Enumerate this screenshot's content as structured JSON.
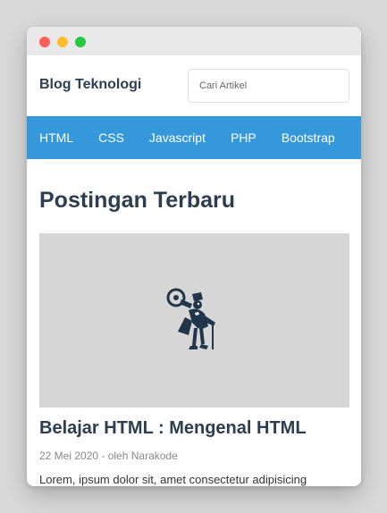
{
  "window": {
    "dot_colors": [
      "#ff5f57",
      "#ffbd2e",
      "#28c940"
    ]
  },
  "header": {
    "brand": "Blog Teknologi",
    "search_placeholder": "Cari Artikel"
  },
  "nav": {
    "color": "#3498db",
    "items": [
      "HTML",
      "CSS",
      "Javascript",
      "PHP",
      "Bootstrap"
    ]
  },
  "main": {
    "section_title": "Postingan Terbaru",
    "post": {
      "thumbnail_icon": "mascot-illustration-icon",
      "title": "Belajar HTML : Mengenal HTML",
      "meta": "22 Mei 2020 - oleh Narakode",
      "excerpt": "Lorem, ipsum dolor sit, amet consectetur adipisicing"
    }
  }
}
